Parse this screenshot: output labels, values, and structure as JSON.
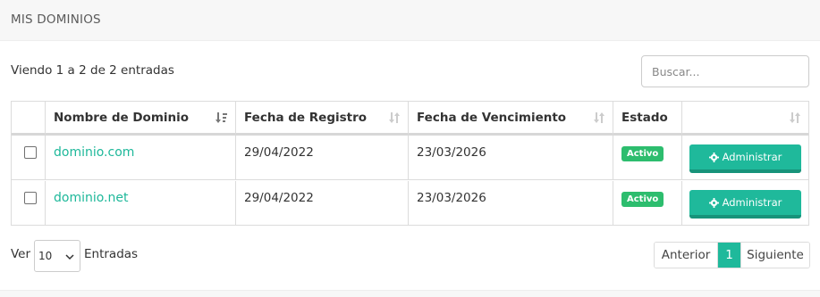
{
  "panel": {
    "title": "MIS DOMINIOS"
  },
  "info": {
    "text": "Viendo 1 a 2 de 2 entradas"
  },
  "search": {
    "placeholder": "Buscar..."
  },
  "table": {
    "headers": [
      "Nombre de Dominio",
      "Fecha de Registro",
      "Fecha de Vencimiento",
      "Estado"
    ],
    "rows": [
      {
        "domain": "dominio.com",
        "registro": "29/04/2022",
        "vencimiento": "23/03/2026",
        "estado": "Activo",
        "action": "Administrar"
      },
      {
        "domain": "dominio.net",
        "registro": "29/04/2022",
        "vencimiento": "23/03/2026",
        "estado": "Activo",
        "action": "Administrar"
      }
    ]
  },
  "length": {
    "ver": "Ver",
    "value": "10",
    "entradas": "Entradas"
  },
  "pagination": {
    "prev": "Anterior",
    "current": "1",
    "next": "Siguiente"
  },
  "colors": {
    "accent": "#1fb99b",
    "badge": "#2dbd6e",
    "link": "#1eb89a"
  }
}
